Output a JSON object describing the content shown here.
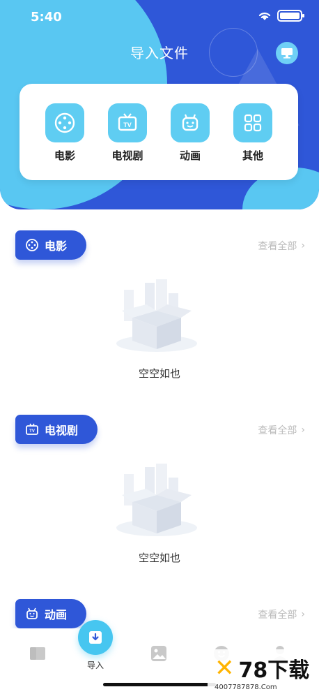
{
  "status": {
    "time": "5:40"
  },
  "header": {
    "title": "导入文件"
  },
  "categories": [
    {
      "label": "电影",
      "icon": "film-reel-icon"
    },
    {
      "label": "电视剧",
      "icon": "tv-icon"
    },
    {
      "label": "动画",
      "icon": "cartoon-robot-icon"
    },
    {
      "label": "其他",
      "icon": "grid-icon"
    }
  ],
  "sections": [
    {
      "tag": "电影",
      "view_all": "查看全部",
      "empty": "空空如也"
    },
    {
      "tag": "电视剧",
      "view_all": "查看全部",
      "empty": "空空如也"
    },
    {
      "tag": "动画",
      "view_all": "查看全部"
    }
  ],
  "tabbar": {
    "import_label": "导入"
  },
  "watermark": {
    "brand": "78下载",
    "url": "4007787878.Com"
  },
  "colors": {
    "primary": "#2f57d8",
    "accent": "#59c7f2"
  }
}
